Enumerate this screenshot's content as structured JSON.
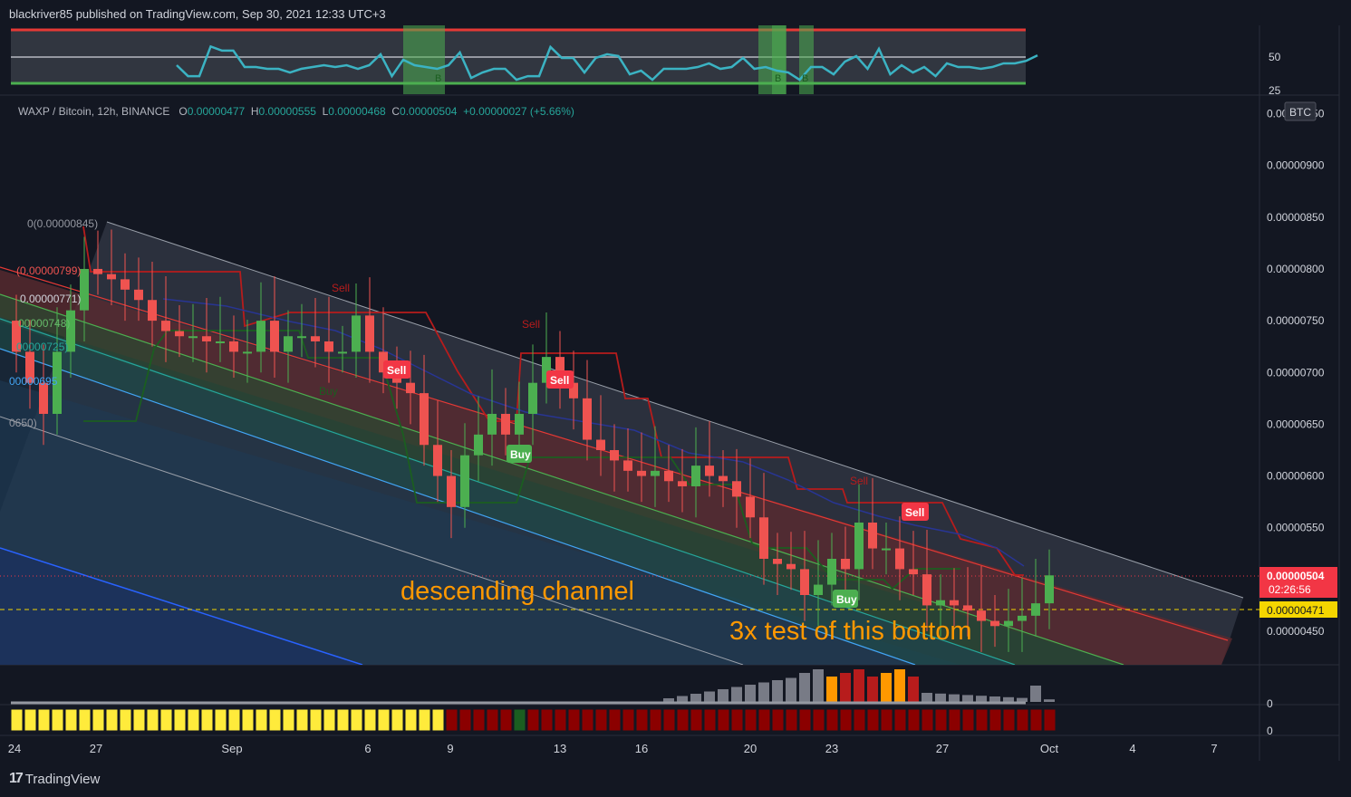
{
  "header": {
    "publisher": "blackriver85 published on TradingView.com, Sep 30, 2021 12:33 UTC+3"
  },
  "footer": {
    "brand": "TradingView"
  },
  "symbol": {
    "name": "WAXP / Bitcoin, 12h, BINANCE",
    "o_label": "O",
    "open": "0.00000477",
    "h_label": "H",
    "high": "0.00000555",
    "l_label": "L",
    "low": "0.00000468",
    "c_label": "C",
    "close": "0.00000504",
    "change": "+0.00000027 (+5.66%)"
  },
  "annotations": {
    "channel": "descending channel",
    "bottom": "3x test of this bottom"
  },
  "price_axis": {
    "currency": "BTC",
    "ticks": [
      "0.00000950",
      "0.00000900",
      "0.00000850",
      "0.00000800",
      "0.00000750",
      "0.00000700",
      "0.00000650",
      "0.00000600",
      "0.00000550",
      "0.00000450"
    ],
    "last_price": "0.00000504",
    "countdown": "02:26:56",
    "level": "0.00000471"
  },
  "rsi_axis": {
    "ticks": [
      "50",
      "25"
    ]
  },
  "volume_axis": {
    "ticks": [
      "0"
    ]
  },
  "bar_axis": {
    "ticks": [
      "0"
    ]
  },
  "time_axis": {
    "ticks": [
      "24",
      "27",
      "Sep",
      "6",
      "9",
      "13",
      "16",
      "20",
      "23",
      "27",
      "Oct",
      "4",
      "7"
    ]
  },
  "fib_labels": [
    "0(0.00000845)",
    "(0.00000799)",
    "0.00000771)",
    "00000748)",
    "00000725)",
    "00000695",
    "0650)"
  ],
  "signals": {
    "sell": "Sell",
    "buy": "Buy",
    "b": "B"
  },
  "colors": {
    "up": "#4caf50",
    "down": "#ef5350",
    "rsi": "#3bb3c3",
    "last_price": "#f23645",
    "level": "#f5d600"
  },
  "chart_data": {
    "type": "candlestick",
    "title": "WAXP / Bitcoin, 12h, BINANCE",
    "ylabel": "BTC",
    "ylim": [
      4.2e-06,
      9.6e-06
    ],
    "x_ticks": [
      "24",
      "27",
      "Sep",
      "6",
      "9",
      "13",
      "16",
      "20",
      "23",
      "27",
      "Oct",
      "4",
      "7"
    ],
    "closes": [
      7.2,
      6.9,
      6.6,
      7.2,
      7.6,
      8.0,
      7.95,
      7.9,
      7.8,
      7.7,
      7.5,
      7.4,
      7.35,
      7.35,
      7.3,
      7.3,
      7.2,
      7.2,
      7.5,
      7.2,
      7.35,
      7.35,
      7.3,
      7.2,
      7.2,
      7.55,
      7.2,
      7.0,
      6.9,
      6.8,
      6.3,
      6.0,
      5.7,
      6.2,
      6.4,
      6.6,
      6.4,
      6.6,
      6.9,
      7.15,
      6.9,
      6.75,
      6.35,
      6.25,
      6.15,
      6.05,
      6.0,
      6.05,
      5.95,
      5.9,
      6.1,
      6.0,
      5.95,
      5.8,
      5.6,
      5.2,
      5.15,
      5.1,
      4.85,
      4.95,
      5.2,
      5.1,
      5.55,
      5.3,
      5.3,
      5.1,
      5.05,
      4.75,
      4.8,
      4.75,
      4.7,
      4.6,
      4.55,
      4.6,
      4.65,
      4.77,
      5.04
    ],
    "volume_note": "histogram",
    "rsi_levels": [
      50,
      25
    ]
  }
}
